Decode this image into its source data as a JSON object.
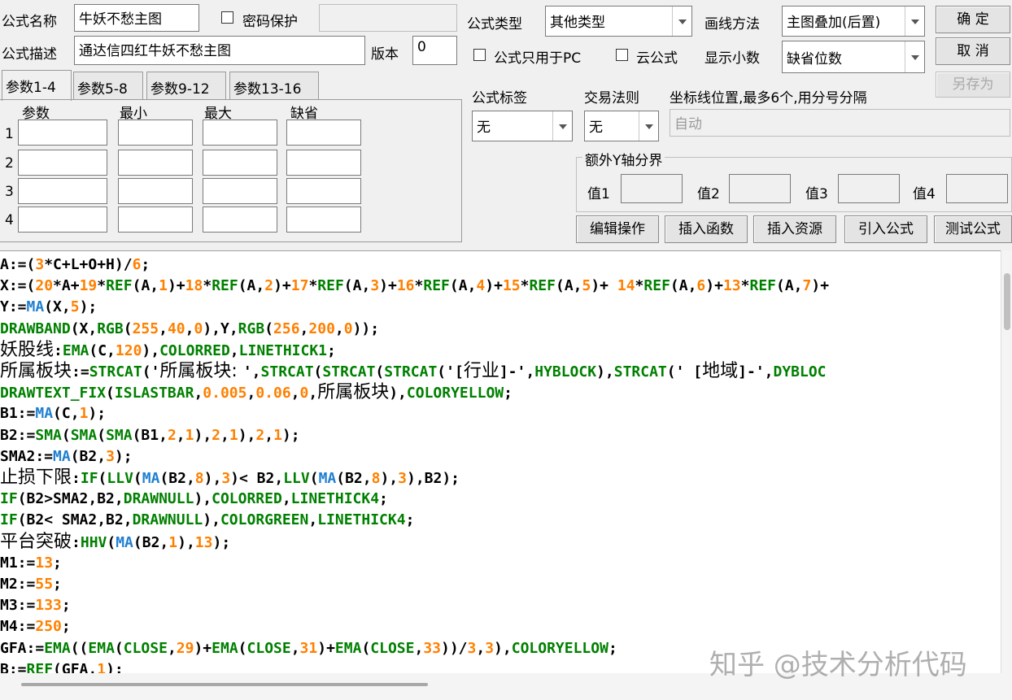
{
  "formula": {
    "name_label": "公式名称",
    "name_value": "牛妖不愁主图",
    "password_label": "密码保护",
    "password_checked": false,
    "password_value": "",
    "desc_label": "公式描述",
    "desc_value": "通达信四红牛妖不愁主图",
    "version_label": "版本",
    "version_value": "0"
  },
  "options": {
    "type_label": "公式类型",
    "type_value": "其他类型",
    "draw_label": "画线方法",
    "draw_value": "主图叠加(后置)",
    "pc_only_label": "公式只用于PC",
    "cloud_label": "云公式",
    "decimals_label": "显示小数",
    "decimals_value": "缺省位数",
    "tag_label": "公式标签",
    "tag_value": "无",
    "rule_label": "交易法则",
    "rule_value": "无",
    "coord_label": "坐标线位置,最多6个,用分号分隔",
    "coord_placeholder": "自动",
    "extra_y_title": "额外Y轴分界",
    "extra_values": [
      "值1",
      "值2",
      "值3",
      "值4"
    ]
  },
  "buttons": {
    "ok": "确 定",
    "cancel": "取 消",
    "save_as": "另存为",
    "edit_ops": "编辑操作",
    "insert_func": "插入函数",
    "insert_res": "插入资源",
    "import_formula": "引入公式",
    "test_formula": "测试公式"
  },
  "tabs": [
    "参数1-4",
    "参数5-8",
    "参数9-12",
    "参数13-16"
  ],
  "params": {
    "headers": [
      "参数",
      "最小",
      "最大",
      "缺省"
    ],
    "rows": [
      "1",
      "2",
      "3",
      "4"
    ]
  },
  "colors": {
    "default": "#000000",
    "func": "#008000",
    "num": "#ff8000",
    "ma": "#1f7fd0",
    "accent": "#000000"
  },
  "code_lines": [
    [
      [
        "A:=(",
        "default"
      ],
      [
        "3",
        "num"
      ],
      [
        "*C+L+O+H)/",
        "default"
      ],
      [
        "6",
        "num"
      ],
      [
        ";",
        "default"
      ]
    ],
    [
      [
        "X:=(",
        "default"
      ],
      [
        "20",
        "num"
      ],
      [
        "*A+",
        "default"
      ],
      [
        "19",
        "num"
      ],
      [
        "*",
        "default"
      ],
      [
        "REF",
        "func"
      ],
      [
        "(A,",
        "default"
      ],
      [
        "1",
        "num"
      ],
      [
        ")+",
        "default"
      ],
      [
        "18",
        "num"
      ],
      [
        "*",
        "default"
      ],
      [
        "REF",
        "func"
      ],
      [
        "(A,",
        "default"
      ],
      [
        "2",
        "num"
      ],
      [
        ")+",
        "default"
      ],
      [
        "17",
        "num"
      ],
      [
        "*",
        "default"
      ],
      [
        "REF",
        "func"
      ],
      [
        "(A,",
        "default"
      ],
      [
        "3",
        "num"
      ],
      [
        ")+",
        "default"
      ],
      [
        "16",
        "num"
      ],
      [
        "*",
        "default"
      ],
      [
        "REF",
        "func"
      ],
      [
        "(A,",
        "default"
      ],
      [
        "4",
        "num"
      ],
      [
        ")+",
        "default"
      ],
      [
        "15",
        "num"
      ],
      [
        "*",
        "default"
      ],
      [
        "REF",
        "func"
      ],
      [
        "(A,",
        "default"
      ],
      [
        "5",
        "num"
      ],
      [
        ")+ ",
        "default"
      ],
      [
        "14",
        "num"
      ],
      [
        "*",
        "default"
      ],
      [
        "REF",
        "func"
      ],
      [
        "(A,",
        "default"
      ],
      [
        "6",
        "num"
      ],
      [
        ")+",
        "default"
      ],
      [
        "13",
        "num"
      ],
      [
        "*",
        "default"
      ],
      [
        "REF",
        "func"
      ],
      [
        "(A,",
        "default"
      ],
      [
        "7",
        "num"
      ],
      [
        ")+",
        "default"
      ]
    ],
    [
      [
        "Y:=",
        "default"
      ],
      [
        "MA",
        "ma"
      ],
      [
        "(X,",
        "default"
      ],
      [
        "5",
        "num"
      ],
      [
        ");",
        "default"
      ]
    ],
    [
      [
        "DRAWBAND",
        "func"
      ],
      [
        "(X,",
        "default"
      ],
      [
        "RGB",
        "func"
      ],
      [
        "(",
        "default"
      ],
      [
        "255",
        "num"
      ],
      [
        ",",
        "default"
      ],
      [
        "40",
        "num"
      ],
      [
        ",",
        "default"
      ],
      [
        "0",
        "num"
      ],
      [
        "),Y,",
        "default"
      ],
      [
        "RGB",
        "func"
      ],
      [
        "(",
        "default"
      ],
      [
        "256",
        "num"
      ],
      [
        ",",
        "default"
      ],
      [
        "200",
        "num"
      ],
      [
        ",",
        "default"
      ],
      [
        "0",
        "num"
      ],
      [
        "));",
        "default"
      ]
    ],
    [
      [
        "妖股线",
        "zh"
      ],
      [
        ":",
        "default"
      ],
      [
        "EMA",
        "func"
      ],
      [
        "(C,",
        "default"
      ],
      [
        "120",
        "num"
      ],
      [
        "),",
        "default"
      ],
      [
        "COLORRED",
        "func"
      ],
      [
        ",",
        "default"
      ],
      [
        "LINETHICK1",
        "func"
      ],
      [
        ";",
        "default"
      ]
    ],
    [
      [
        "所属板块",
        "zh"
      ],
      [
        ":=",
        "default"
      ],
      [
        "STRCAT",
        "func"
      ],
      [
        "('",
        "default"
      ],
      [
        "所属板块: ",
        "zh"
      ],
      [
        "',",
        "default"
      ],
      [
        "STRCAT",
        "func"
      ],
      [
        "(",
        "default"
      ],
      [
        "STRCAT",
        "func"
      ],
      [
        "(",
        "default"
      ],
      [
        "STRCAT",
        "func"
      ],
      [
        "('[",
        "default"
      ],
      [
        "行业",
        "zh"
      ],
      [
        "]-',",
        "default"
      ],
      [
        "HYBLOCK",
        "func"
      ],
      [
        "),",
        "default"
      ],
      [
        "STRCAT",
        "func"
      ],
      [
        "(' [",
        "default"
      ],
      [
        "地域",
        "zh"
      ],
      [
        "]-',",
        "default"
      ],
      [
        "DYBLOC",
        "func"
      ]
    ],
    [
      [
        "DRAWTEXT_FIX",
        "func"
      ],
      [
        "(",
        "default"
      ],
      [
        "ISLASTBAR",
        "func"
      ],
      [
        ",",
        "default"
      ],
      [
        "0.005",
        "num"
      ],
      [
        ",",
        "default"
      ],
      [
        "0.06",
        "num"
      ],
      [
        ",",
        "default"
      ],
      [
        "0",
        "num"
      ],
      [
        ",",
        "default"
      ],
      [
        "所属板块",
        "zh"
      ],
      [
        "),",
        "default"
      ],
      [
        "COLORYELLOW",
        "func"
      ],
      [
        ";",
        "default"
      ]
    ],
    [
      [
        "B1:=",
        "default"
      ],
      [
        "MA",
        "ma"
      ],
      [
        "(C,",
        "default"
      ],
      [
        "1",
        "num"
      ],
      [
        ");",
        "default"
      ]
    ],
    [
      [
        "B2:=",
        "default"
      ],
      [
        "SMA",
        "func"
      ],
      [
        "(",
        "default"
      ],
      [
        "SMA",
        "func"
      ],
      [
        "(",
        "default"
      ],
      [
        "SMA",
        "func"
      ],
      [
        "(B1,",
        "default"
      ],
      [
        "2",
        "num"
      ],
      [
        ",",
        "default"
      ],
      [
        "1",
        "num"
      ],
      [
        "),",
        "default"
      ],
      [
        "2",
        "num"
      ],
      [
        ",",
        "default"
      ],
      [
        "1",
        "num"
      ],
      [
        "),",
        "default"
      ],
      [
        "2",
        "num"
      ],
      [
        ",",
        "default"
      ],
      [
        "1",
        "num"
      ],
      [
        ");",
        "default"
      ]
    ],
    [
      [
        "SMA2:=",
        "default"
      ],
      [
        "MA",
        "ma"
      ],
      [
        "(B2,",
        "default"
      ],
      [
        "3",
        "num"
      ],
      [
        ");",
        "default"
      ]
    ],
    [
      [
        "止损下限",
        "zh"
      ],
      [
        ":",
        "default"
      ],
      [
        "IF",
        "func"
      ],
      [
        "(",
        "default"
      ],
      [
        "LLV",
        "func"
      ],
      [
        "(",
        "default"
      ],
      [
        "MA",
        "ma"
      ],
      [
        "(B2,",
        "default"
      ],
      [
        "8",
        "num"
      ],
      [
        "),",
        "default"
      ],
      [
        "3",
        "num"
      ],
      [
        ")< B2,",
        "default"
      ],
      [
        "LLV",
        "func"
      ],
      [
        "(",
        "default"
      ],
      [
        "MA",
        "ma"
      ],
      [
        "(B2,",
        "default"
      ],
      [
        "8",
        "num"
      ],
      [
        "),",
        "default"
      ],
      [
        "3",
        "num"
      ],
      [
        "),B2);",
        "default"
      ]
    ],
    [
      [
        "IF",
        "func"
      ],
      [
        "(B2>SMA2,B2,",
        "default"
      ],
      [
        "DRAWNULL",
        "func"
      ],
      [
        "),",
        "default"
      ],
      [
        "COLORRED",
        "func"
      ],
      [
        ",",
        "default"
      ],
      [
        "LINETHICK4",
        "func"
      ],
      [
        ";",
        "default"
      ]
    ],
    [
      [
        "IF",
        "func"
      ],
      [
        "(B2< SMA2,B2,",
        "default"
      ],
      [
        "DRAWNULL",
        "func"
      ],
      [
        "),",
        "default"
      ],
      [
        "COLORGREEN",
        "func"
      ],
      [
        ",",
        "default"
      ],
      [
        "LINETHICK4",
        "func"
      ],
      [
        ";",
        "default"
      ]
    ],
    [
      [
        "平台突破",
        "zh"
      ],
      [
        ":",
        "default"
      ],
      [
        "HHV",
        "func"
      ],
      [
        "(",
        "default"
      ],
      [
        "MA",
        "ma"
      ],
      [
        "(B2,",
        "default"
      ],
      [
        "1",
        "num"
      ],
      [
        "),",
        "default"
      ],
      [
        "13",
        "num"
      ],
      [
        ");",
        "default"
      ]
    ],
    [
      [
        "M1:=",
        "default"
      ],
      [
        "13",
        "num"
      ],
      [
        ";",
        "default"
      ]
    ],
    [
      [
        "M2:=",
        "default"
      ],
      [
        "55",
        "num"
      ],
      [
        ";",
        "default"
      ]
    ],
    [
      [
        "M3:=",
        "default"
      ],
      [
        "133",
        "num"
      ],
      [
        ";",
        "default"
      ]
    ],
    [
      [
        "M4:=",
        "default"
      ],
      [
        "250",
        "num"
      ],
      [
        ";",
        "default"
      ]
    ],
    [
      [
        "GFA:=",
        "default"
      ],
      [
        "EMA",
        "func"
      ],
      [
        "((",
        "default"
      ],
      [
        "EMA",
        "func"
      ],
      [
        "(",
        "default"
      ],
      [
        "CLOSE",
        "func"
      ],
      [
        ",",
        "default"
      ],
      [
        "29",
        "num"
      ],
      [
        ")+",
        "default"
      ],
      [
        "EMA",
        "func"
      ],
      [
        "(",
        "default"
      ],
      [
        "CLOSE",
        "func"
      ],
      [
        ",",
        "default"
      ],
      [
        "31",
        "num"
      ],
      [
        ")+",
        "default"
      ],
      [
        "EMA",
        "func"
      ],
      [
        "(",
        "default"
      ],
      [
        "CLOSE",
        "func"
      ],
      [
        ",",
        "default"
      ],
      [
        "33",
        "num"
      ],
      [
        "))/",
        "default"
      ],
      [
        "3",
        "num"
      ],
      [
        ",",
        "default"
      ],
      [
        "3",
        "num"
      ],
      [
        "),",
        "default"
      ],
      [
        "COLORYELLOW",
        "func"
      ],
      [
        ";",
        "default"
      ]
    ],
    [
      [
        "B:=",
        "default"
      ],
      [
        "REF",
        "func"
      ],
      [
        "(GFA,",
        "default"
      ],
      [
        "1",
        "num"
      ],
      [
        ");",
        "default"
      ]
    ]
  ],
  "watermark": "知乎 @技术分析代码"
}
